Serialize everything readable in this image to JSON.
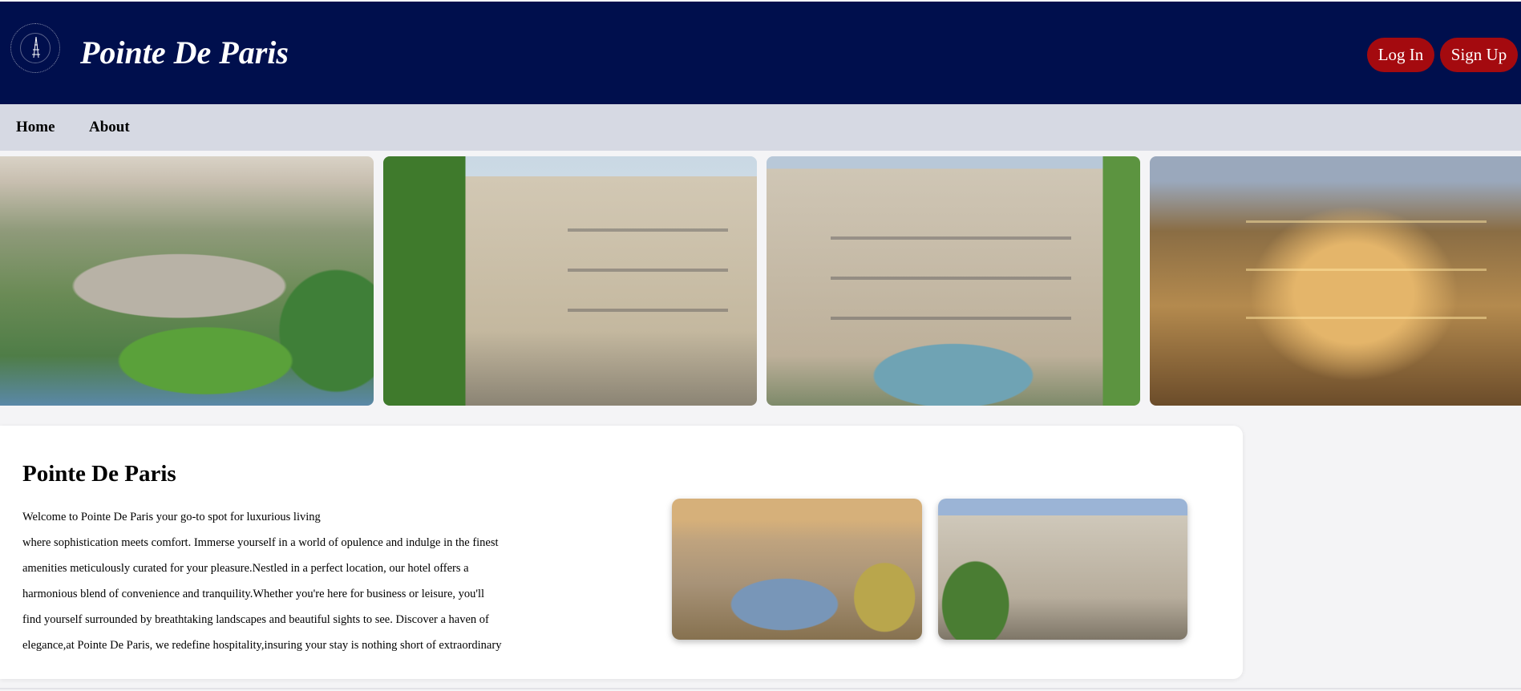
{
  "header": {
    "title": "Pointe De Paris",
    "login_label": "Log In",
    "signup_label": "Sign Up",
    "logo_icon": "eiffel-seal-logo"
  },
  "nav": {
    "items": [
      {
        "label": "Home"
      },
      {
        "label": "About"
      }
    ]
  },
  "gallery": {
    "images": [
      {
        "name": "paris-aerial-palace"
      },
      {
        "name": "haussmann-corner-building"
      },
      {
        "name": "city-hall-fountain"
      },
      {
        "name": "illuminated-corner-building"
      }
    ]
  },
  "intro": {
    "title": "Pointe De Paris",
    "lines": [
      "Welcome to Pointe De Paris your go-to spot for luxurious living",
      "where sophistication meets comfort. Immerse yourself in a world of opulence and indulge in the finest",
      "amenities meticulously curated for your pleasure.Nestled in a perfect location, our hotel offers a",
      "harmonious blend of convenience and tranquility.Whether you're here for business or leisure, you'll",
      "find yourself surrounded by breathtaking landscapes and beautiful sights to see. Discover a haven of",
      "elegance,at Pointe De Paris, we redefine hospitality,insuring your stay is nothing short of extraordinary"
    ],
    "thumbnails": [
      {
        "name": "paris-skyline-eiffel"
      },
      {
        "name": "building-street-lamp"
      }
    ]
  },
  "colors": {
    "header_bg": "#000f4d",
    "nav_bg": "#d6d9e3",
    "button_bg": "#a40a0f"
  }
}
